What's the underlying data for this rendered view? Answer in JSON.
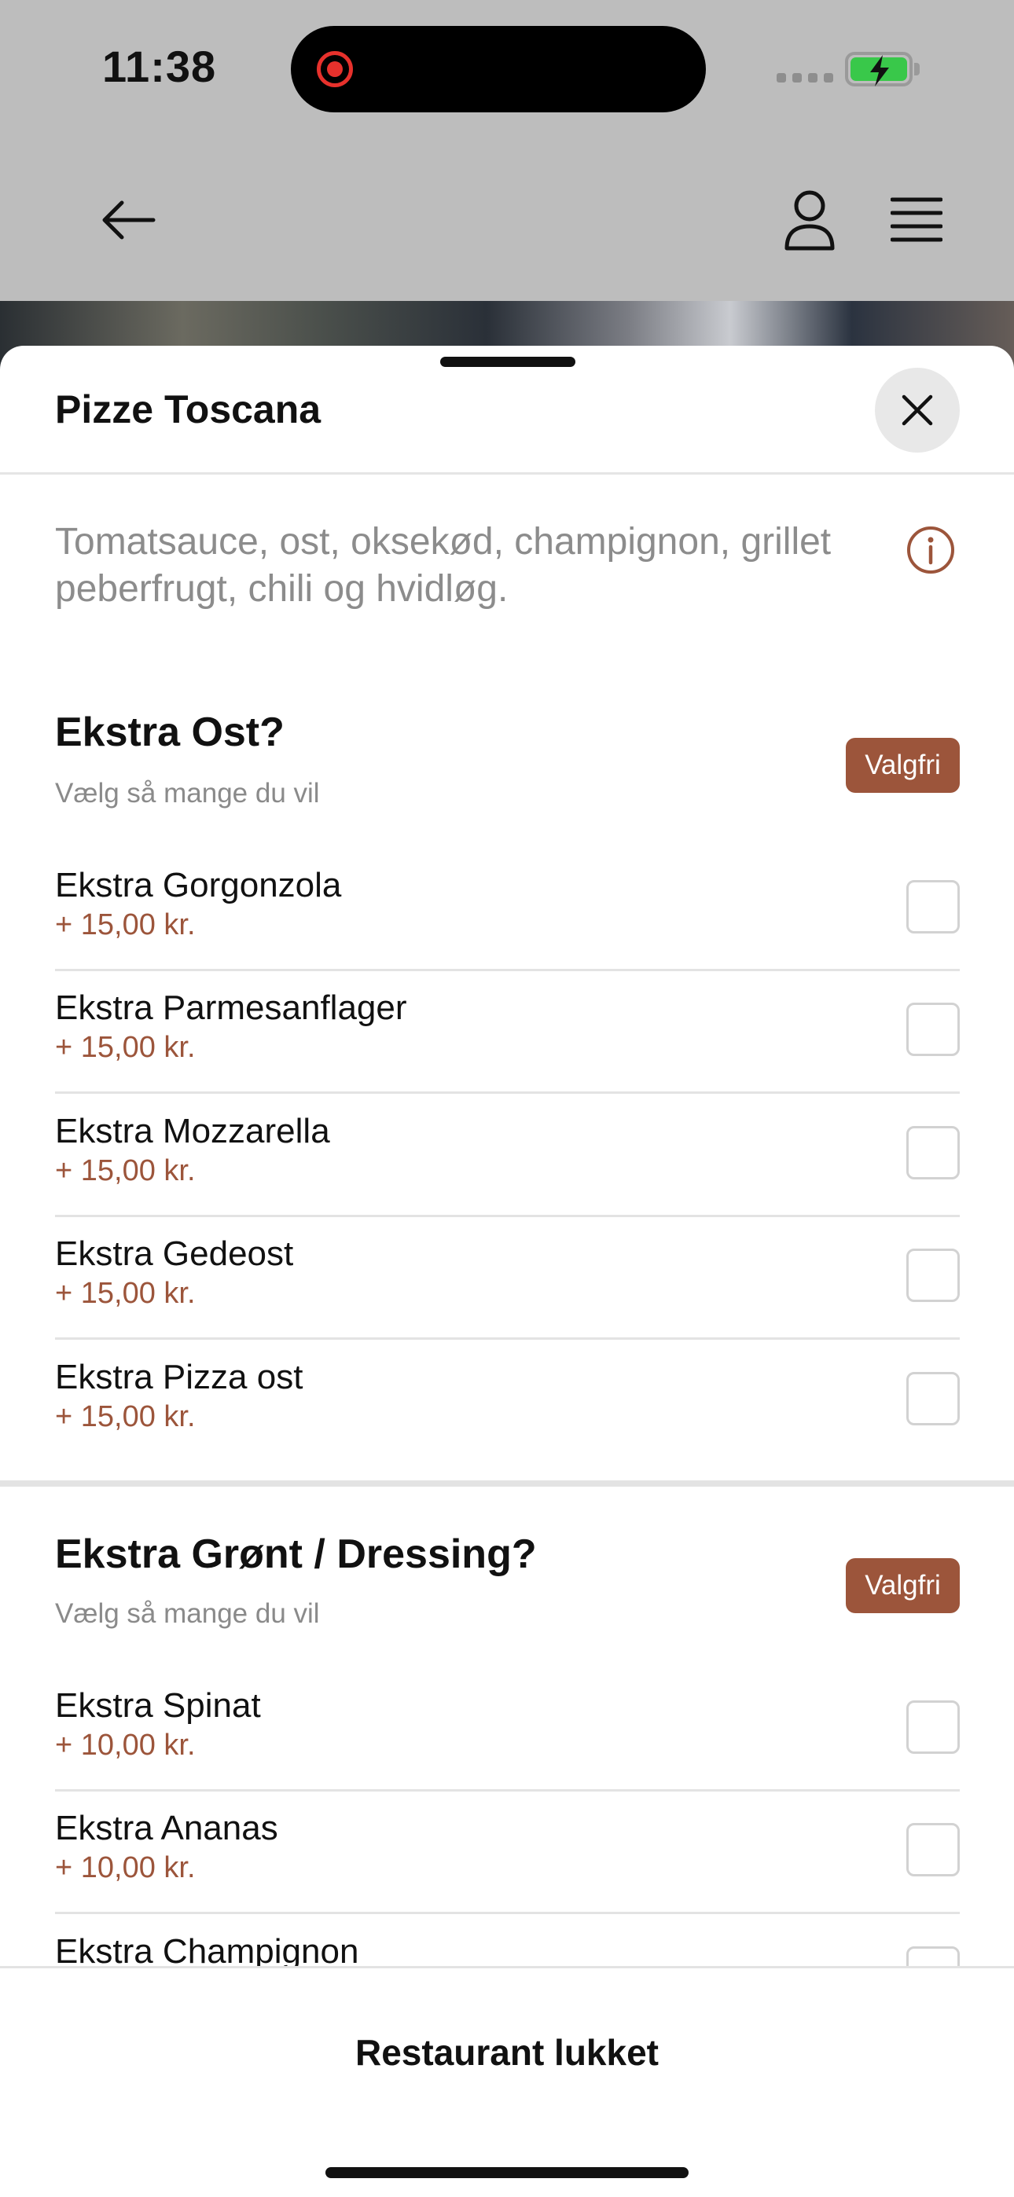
{
  "status_bar": {
    "time": "11:38"
  },
  "product": {
    "title": "Pizze Toscana",
    "description": "Tomatsauce, ost, oksekød, champignon, grillet peberfrugt, chili og hvidløg."
  },
  "sections": [
    {
      "title": "Ekstra Ost?",
      "subtitle": "Vælg så mange du vil",
      "badge": "Valgfri",
      "options": [
        {
          "name": "Ekstra Gorgonzola",
          "price": "+ 15,00 kr."
        },
        {
          "name": "Ekstra Parmesanflager",
          "price": "+ 15,00 kr."
        },
        {
          "name": "Ekstra Mozzarella",
          "price": "+ 15,00 kr."
        },
        {
          "name": "Ekstra Gedeost",
          "price": "+ 15,00 kr."
        },
        {
          "name": "Ekstra Pizza ost",
          "price": "+ 15,00 kr."
        }
      ]
    },
    {
      "title": "Ekstra Grønt / Dressing?",
      "subtitle": "Vælg så mange du vil",
      "badge": "Valgfri",
      "options": [
        {
          "name": "Ekstra Spinat",
          "price": "+ 10,00 kr."
        },
        {
          "name": "Ekstra Ananas",
          "price": "+ 10,00 kr."
        },
        {
          "name": "Ekstra Champignon",
          "price": ""
        }
      ]
    }
  ],
  "footer": {
    "label": "Restaurant lukket"
  },
  "colors": {
    "accent": "#9c553b",
    "battery": "#39c84a",
    "recording": "#e7312c"
  }
}
